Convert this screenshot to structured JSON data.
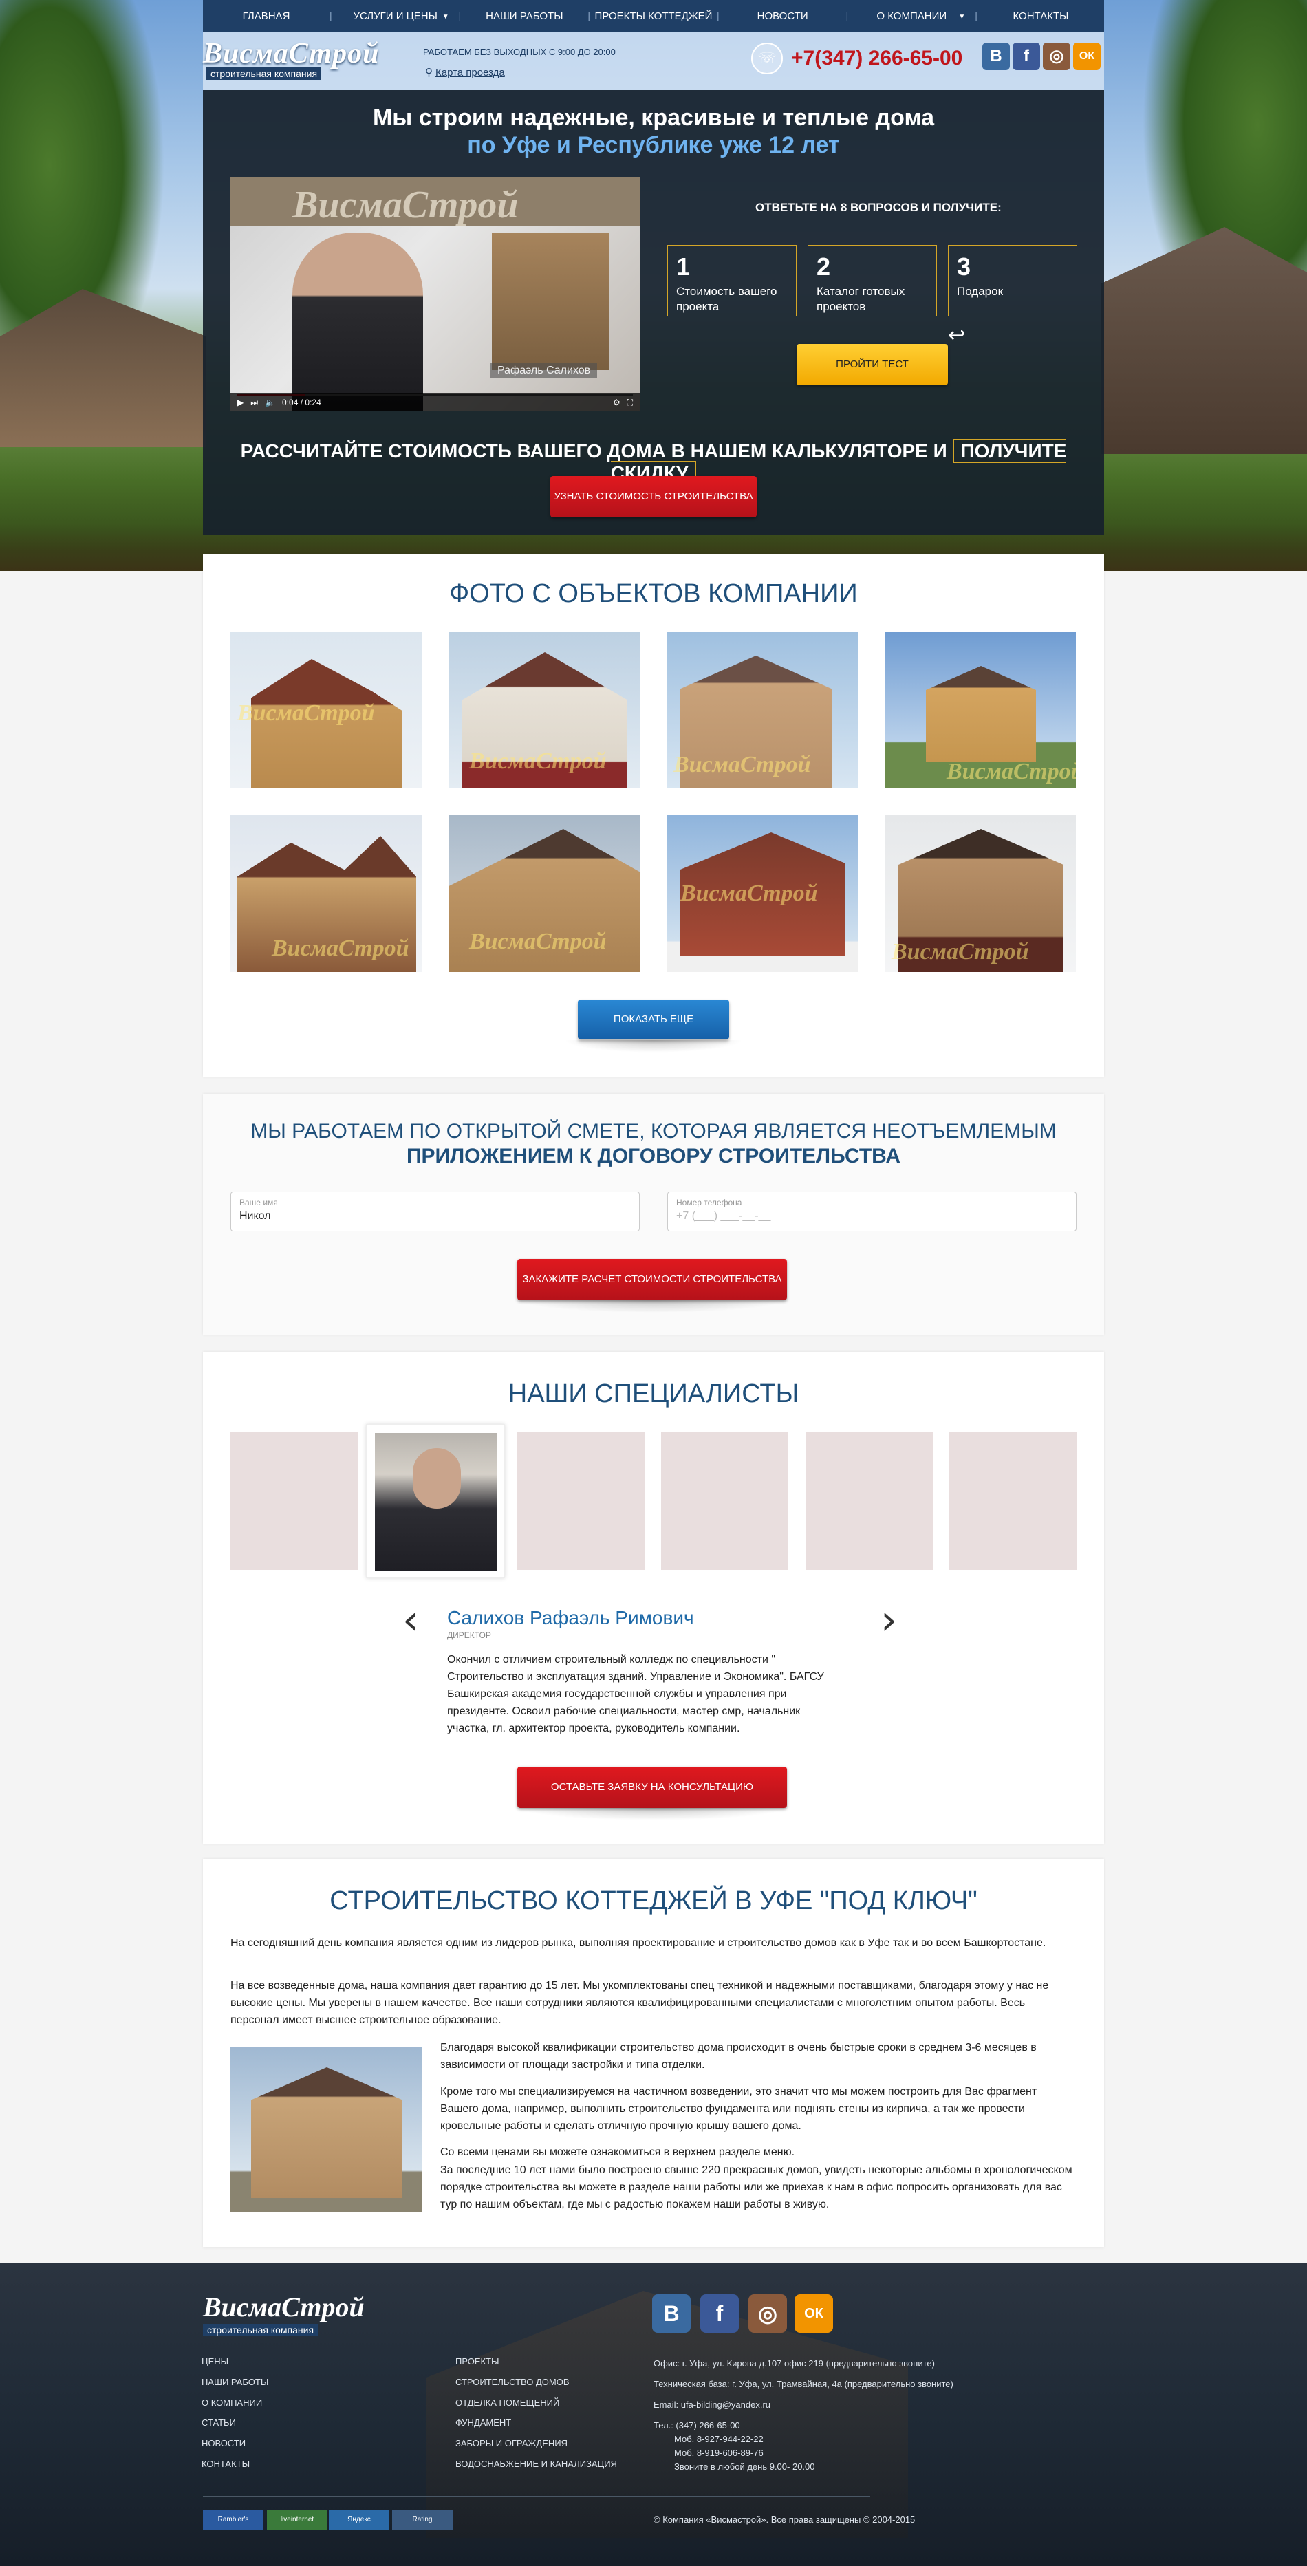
{
  "nav": {
    "items": [
      "ГЛАВНАЯ",
      "УСЛУГИ И ЦЕНЫ",
      "НАШИ РАБОТЫ",
      "ПРОЕКТЫ КОТТЕДЖЕЙ",
      "НОВОСТИ",
      "О КОМПАНИИ",
      "КОНТАКТЫ"
    ]
  },
  "header": {
    "logo_title": "ВисмаСтрой",
    "logo_subtitle": "строительная компания",
    "hours": "РАБОТАЕМ БЕЗ ВЫХОДНЫХ С 9:00 ДО 20:00",
    "map_link": "Карта проезда",
    "phone": "+7(347) 266-65-00",
    "social": [
      "В",
      "f",
      "◎",
      "ОК"
    ]
  },
  "hero": {
    "title_line1": "Мы строим надежные, красивые и теплые дома",
    "title_line2": "по Уфе и Республике уже 12 лет",
    "video_caption": "Рафаэль Салихов",
    "video_time": "0:04 / 0:24",
    "video_progress": 0.17,
    "quiz_title": "ОТВЕТЬТЕ НА 8 ВОПРОСОВ И ПОЛУЧИТЕ:",
    "quiz_items": [
      {
        "num": "1",
        "text": "Стоимость вашего проекта"
      },
      {
        "num": "2",
        "text": "Каталог готовых проектов"
      },
      {
        "num": "3",
        "text": "Подарок"
      }
    ],
    "quiz_button": "ПРОЙТИ ТЕСТ",
    "calc_text": "РАССЧИТАЙТЕ СТОИМОСТЬ ВАШЕГО ДОМА В НАШЕМ КАЛЬКУЛЯТОРЕ И",
    "calc_highlight": "ПОЛУЧИТЕ СКИДКУ",
    "calc_button": "УЗНАТЬ СТОИМОСТЬ СТРОИТЕЛЬСТВА"
  },
  "photos": {
    "title": "ФОТО С ОБЪЕКТОВ КОМПАНИИ",
    "watermark": "ВисмаСтрой",
    "more_button": "ПОКАЗАТЬ ЕЩЕ"
  },
  "estimate": {
    "title_line1": "МЫ РАБОТАЕМ ПО ОТКРЫТОЙ СМЕТЕ, КОТОРАЯ ЯВЛЯЕТСЯ НЕОТЪЕМЛЕМЫМ",
    "title_line2": "ПРИЛОЖЕНИЕМ К ДОГОВОРУ СТРОИТЕЛЬСТВА",
    "name_label": "Ваше имя",
    "name_value": "Никол",
    "phone_label": "Номер телефона",
    "phone_placeholder": "+7 (___) ___-__-__",
    "button": "ЗАКАЖИТЕ РАСЧЕТ СТОИМОСТИ СТРОИТЕЛЬСТВА"
  },
  "specialists": {
    "title": "НАШИ СПЕЦИАЛИСТЫ",
    "name": "Салихов Рафаэль Римович",
    "role": "ДИРЕКТОР",
    "bio": "Окончил с отличием строительный колледж по специальности \" Строительство и эксплуатация зданий. Управление и Экономика\". БАГСУ Башкирская академия государственной службы и управления при президенте. Освоил рабочие специальности, мастер смр, начальник участка, гл. архитектор проекта, руководитель компании.",
    "button": "ОСТАВЬТЕ ЗАЯВКУ НА КОНСУЛЬТАЦИЮ"
  },
  "about": {
    "title": "СТРОИТЕЛЬСТВО КОТТЕДЖЕЙ В УФЕ \"ПОД КЛЮЧ\"",
    "p1": "На сегодняшний день компания является одним из лидеров рынка, выполняя проектирование и строительство домов как в Уфе так и во всем Башкортостане.",
    "p2": "На все возведенные дома, наша компания дает гарантию до 15 лет. Мы укомплектованы спец техникой и надежными поставщиками, благодаря этому у нас не высокие цены. Мы уверены в нашем качестве. Все наши сотрудники являются квалифицированными специалистами с многолетним опытом работы. Весь персонал имеет высшее строительное образование.",
    "p3": "Благодаря высокой квалификации строительство дома происходит в очень быстрые сроки в среднем 3-6 месяцев в зависимости от площади застройки и типа отделки.",
    "p4": "Кроме того мы специализируемся на частичном возведении, это значит что мы можем построить для Вас фрагмент Вашего дома, например, выполнить строительство фундамента или поднять стены из кирпича, а так же провести кровельные работы и сделать отличную прочную крышу вашего дома.",
    "p5": "Со всеми ценами вы можете ознакомиться в верхнем разделе меню.",
    "p6": "За последние 10 лет нами было построено свыше 220 прекрасных домов, увидеть некоторые альбомы в хронологическом порядке строительства вы можете в разделе наши работы или же приехав к нам в офис попросить организовать для вас тур по нашим объектам, где мы с радостью покажем наши работы в живую."
  },
  "footer": {
    "logo_title": "ВисмаСтрой",
    "logo_subtitle": "строительная компания",
    "col1": [
      "ЦЕНЫ",
      "НАШИ РАБОТЫ",
      "О КОМПАНИИ",
      "СТАТЬИ",
      "НОВОСТИ",
      "КОНТАКТЫ"
    ],
    "col2": [
      "ПРОЕКТЫ",
      "СТРОИТЕЛЬСТВО ДОМОВ",
      "ОТДЕЛКА ПОМЕЩЕНИЙ",
      "ФУНДАМЕНТ",
      "ЗАБОРЫ И ОГРАЖДЕНИЯ",
      "ВОДОСНАБЖЕНИЕ И КАНАЛИЗАЦИЯ"
    ],
    "info": [
      "Офис: г. Уфа, ул. Кирова д.107   офис 219 (предварительно звоните)",
      "Техническая база: г. Уфа, ул. Трамвайная, 4а (предварительно звоните)",
      "Email: ufa-bilding@yandex.ru",
      "Тел.: (347) 266-65-00",
      "Моб. 8-927-944-22-22",
      "Моб. 8-919-606-89-76",
      "Звоните в любой день 9.00- 20.00"
    ],
    "copyright": "© Компания «Висмастрой». Все права защищены © 2004-2015",
    "badges": [
      "Rambler's",
      "liveinternet",
      "Яндекс",
      "Rating"
    ],
    "social": [
      "В",
      "f",
      "◎",
      "ОК"
    ]
  }
}
